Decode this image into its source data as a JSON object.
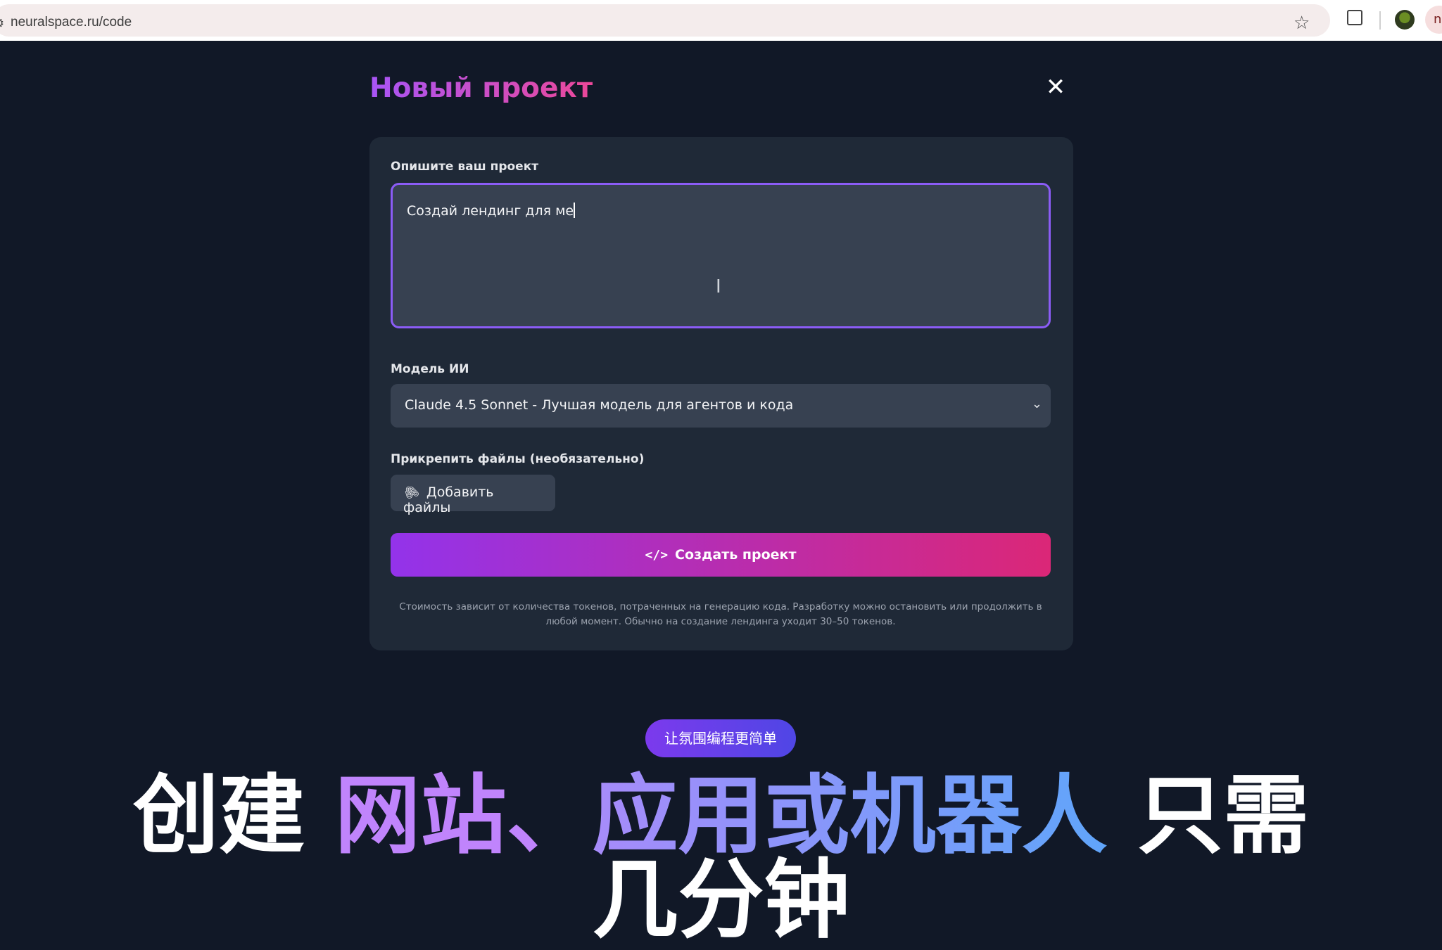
{
  "browser": {
    "url": "neuralspace.ru/code",
    "profile_initial": "n"
  },
  "modal": {
    "title": "Новый проект",
    "close_symbol": "✕",
    "description_label": "Опишите ваш проект",
    "description_value": "Создай лендинг для ме",
    "model_label": "Модель ИИ",
    "model_selected": "Claude 4.5 Sonnet - Лучшая модель для агентов и кода",
    "attach_label": "Прикрепить файлы (необязательно)",
    "attach_button": "Добавить файлы",
    "create_button": "Создать проект",
    "note": "Стоимость зависит от количества токенов, потраченных на генерацию кода. Разработку можно остановить или продолжить в любой момент. Обычно на создание лендинга уходит 30–50 токенов."
  },
  "promo": {
    "pill": "让氛围编程更简单",
    "headline_part1": "创建 ",
    "headline_part2": "网站、",
    "headline_part3": "应用或机器人",
    "headline_part4": " 只需",
    "headline_line2": "几分钟"
  },
  "icons": {
    "site_info": "tune-icon",
    "bookmark": "star-icon",
    "extensions": "puzzle-icon",
    "attach": "paperclip-icon",
    "create": "code-icon",
    "dropdown": "chevron-down-icon"
  },
  "colors": {
    "background": "#111827",
    "card": "#1f2937",
    "input": "#374151",
    "focus_border": "#8b5cf6",
    "gradient_start": "#9333ea",
    "gradient_end": "#db2777"
  }
}
